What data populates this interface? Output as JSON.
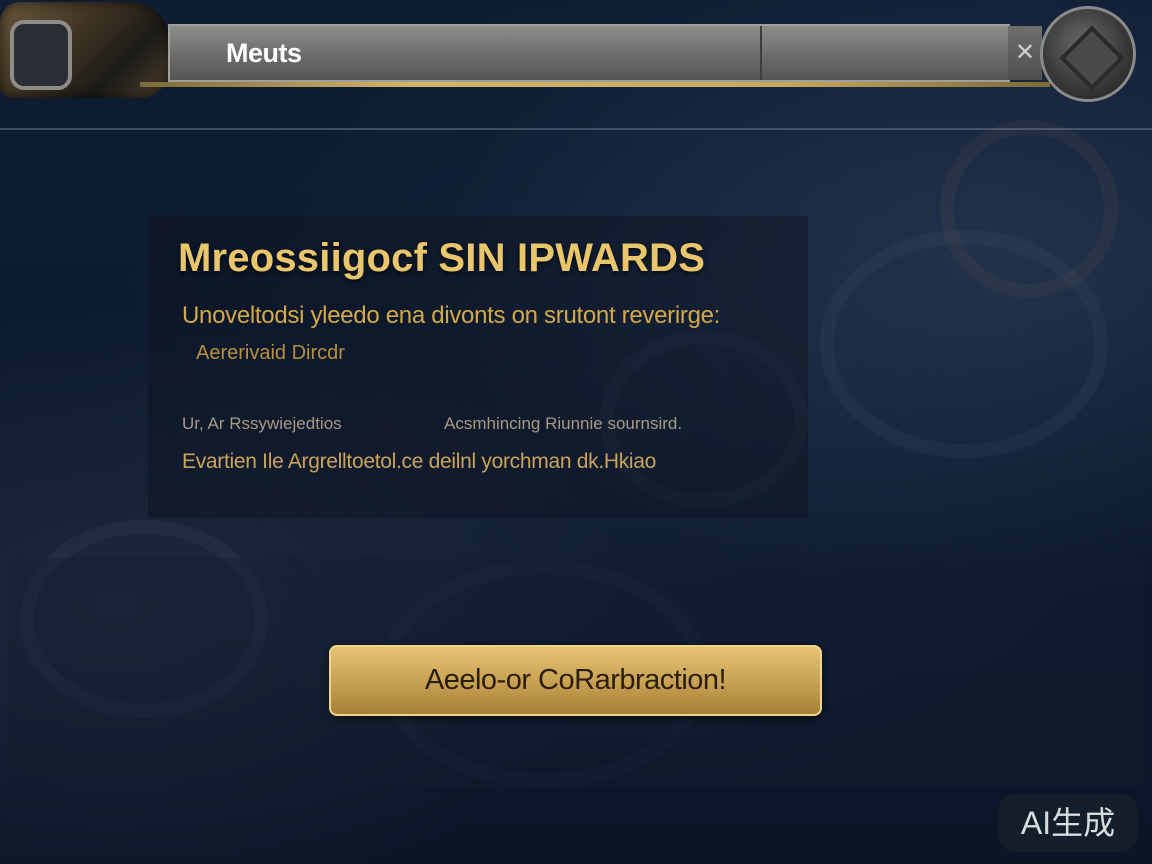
{
  "header": {
    "title": "Meuts",
    "close_glyph": "✕",
    "left_emblem_icon": "ornate-emblem-icon",
    "right_emblem_icon": "round-crest-icon"
  },
  "reward_panel": {
    "heading": "Mreossiigocf SIN IPWARDS",
    "subtitle": "Unoveltodsi yleedo ena divonts on srutont reverirge:",
    "subtitle_line2": "Aererivaid Dircdr",
    "info_left": "Ur, Ar Rssywiejedtios",
    "info_right": "Acsmhincing Riunnie sournsird.",
    "info_line": "Evartien Ile Argrelltoetol.ce deilnl yorchman dk.Hkiao"
  },
  "action": {
    "button_label": "Aeelo-or CoRarbraction!"
  },
  "watermark": "AI生成",
  "colors": {
    "accent_gold": "#e9c56c",
    "background": "#0b1526",
    "title_bar": "#6c6c6a"
  }
}
